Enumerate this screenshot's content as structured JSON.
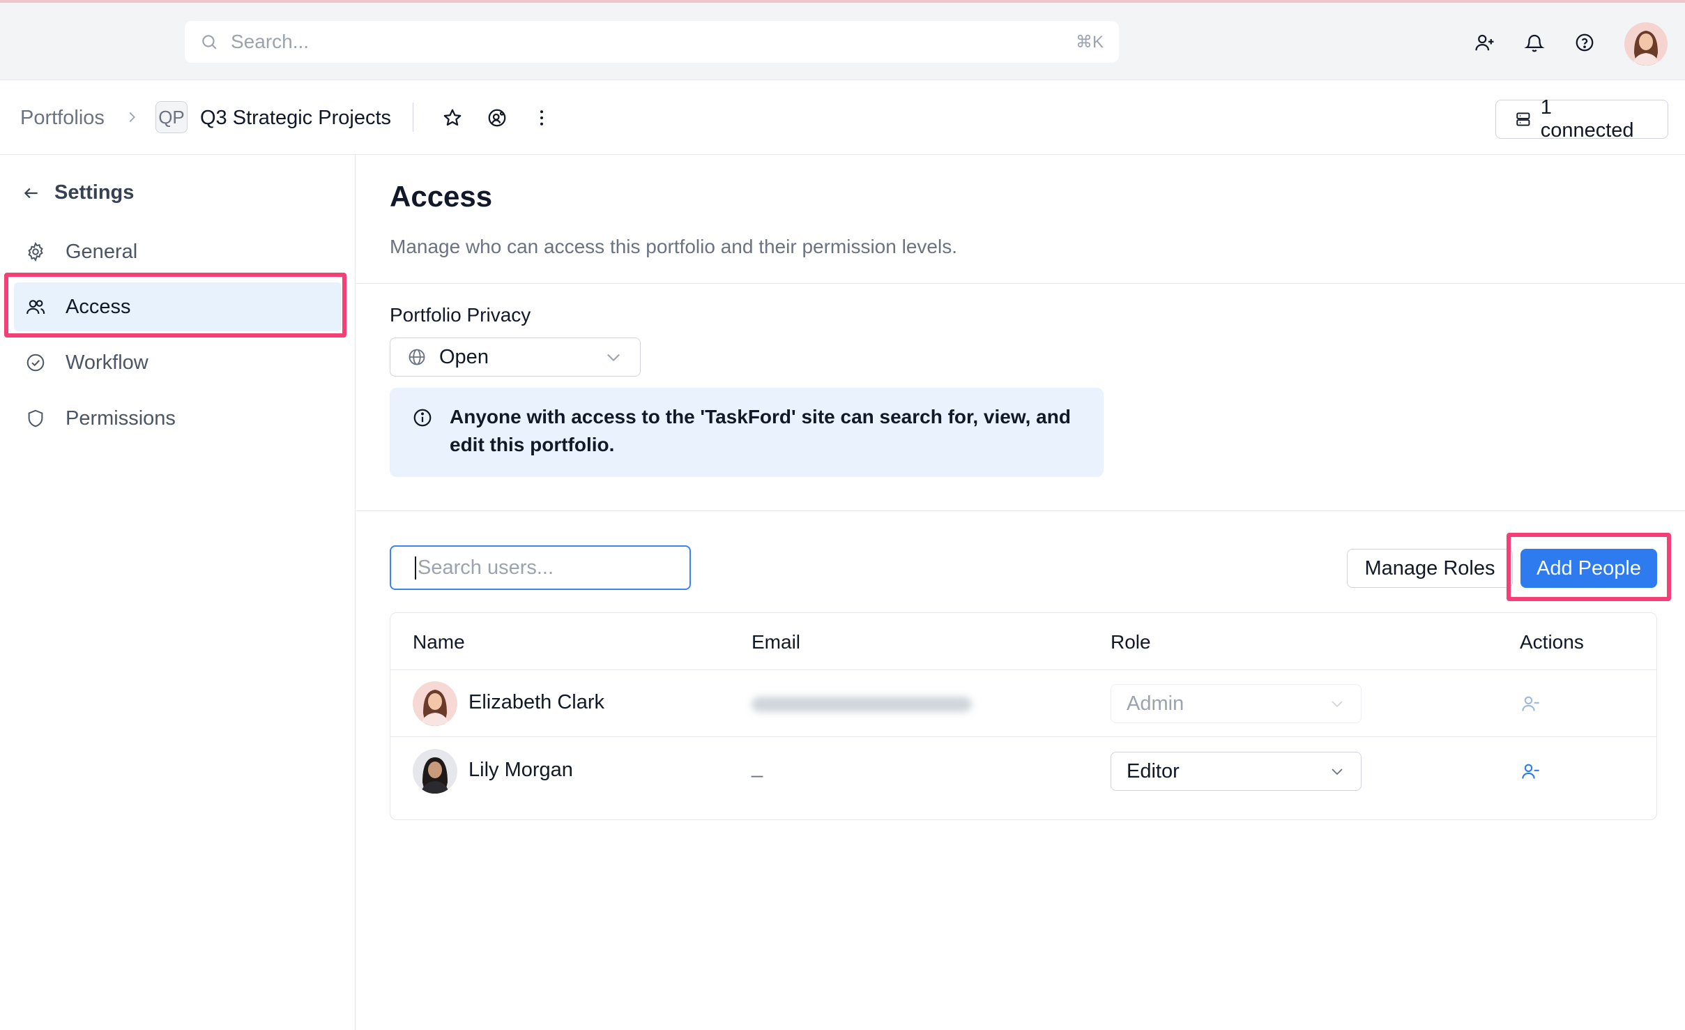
{
  "top_bar": {
    "search_placeholder": "Search...",
    "search_shortcut": "⌘K",
    "icons": [
      "search-icon",
      "add-user-icon",
      "bell-icon",
      "help-icon",
      "avatar"
    ]
  },
  "header": {
    "breadcrumb_root": "Portfolios",
    "project_badge": "QP",
    "project_name": "Q3 Strategic Projects",
    "connected_label": "1 connected"
  },
  "sidebar": {
    "back_label": "Settings",
    "items": [
      {
        "label": "General",
        "icon": "gear-icon"
      },
      {
        "label": "Access",
        "icon": "users-icon",
        "active": true
      },
      {
        "label": "Workflow",
        "icon": "check-circle-icon"
      },
      {
        "label": "Permissions",
        "icon": "shield-icon"
      }
    ]
  },
  "main": {
    "title": "Access",
    "description": "Manage who can access this portfolio and their permission levels.",
    "privacy_label": "Portfolio Privacy",
    "privacy_value": "Open",
    "privacy_info": "Anyone with access to the 'TaskFord' site can search for, view, and edit this portfolio.",
    "user_search_placeholder": "Search users...",
    "manage_roles_label": "Manage Roles",
    "add_people_label": "Add People",
    "table": {
      "headers": [
        "Name",
        "Email",
        "Role",
        "Actions"
      ],
      "rows": [
        {
          "name": "Elizabeth Clark",
          "email": "",
          "role": "Admin",
          "role_editable": false
        },
        {
          "name": "Lily Morgan",
          "email": "_",
          "role": "Editor",
          "role_editable": true
        }
      ]
    }
  },
  "colors": {
    "accent": "#2e7bf0",
    "highlight": "#f43f77",
    "active_bg": "#e8f2fd",
    "info_bg": "#eaf2fd"
  }
}
